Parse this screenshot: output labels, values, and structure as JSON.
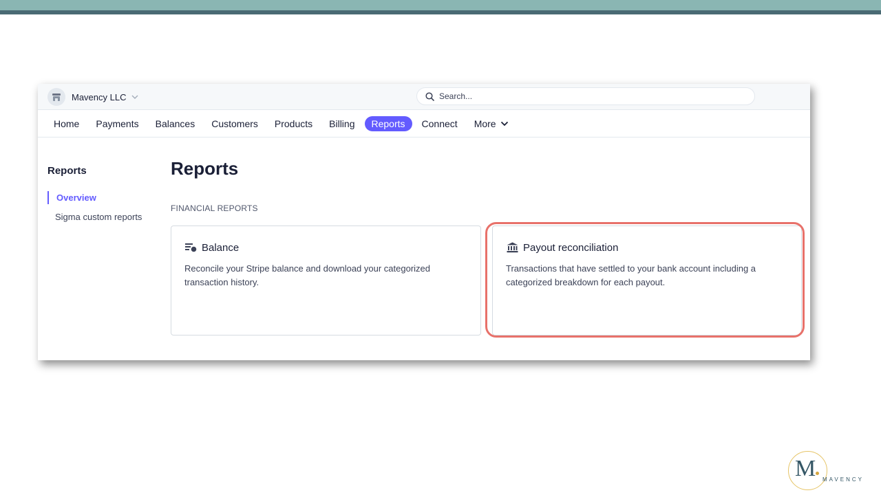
{
  "colors": {
    "accent": "#635bff",
    "highlight_ring": "#e8716a",
    "band_top": "#8ab6b3",
    "band_line": "#4a6a74",
    "logo_gold": "#e6c466",
    "logo_text": "#355766"
  },
  "topbar": {
    "account_name": "Mavency LLC",
    "account_icon": "store-icon",
    "search_placeholder": "Search..."
  },
  "nav": {
    "items": [
      {
        "label": "Home",
        "active": false
      },
      {
        "label": "Payments",
        "active": false
      },
      {
        "label": "Balances",
        "active": false
      },
      {
        "label": "Customers",
        "active": false
      },
      {
        "label": "Products",
        "active": false
      },
      {
        "label": "Billing",
        "active": false
      },
      {
        "label": "Reports",
        "active": true
      },
      {
        "label": "Connect",
        "active": false
      },
      {
        "label": "More",
        "active": false
      }
    ]
  },
  "sidebar": {
    "title": "Reports",
    "items": [
      {
        "label": "Overview",
        "active": true
      },
      {
        "label": "Sigma custom reports",
        "active": false
      }
    ]
  },
  "main": {
    "title": "Reports",
    "section_label": "FINANCIAL REPORTS",
    "cards": [
      {
        "icon": "balance-report-icon",
        "title": "Balance",
        "description": "Reconcile your Stripe balance and download your categorized transaction history."
      },
      {
        "icon": "bank-icon",
        "title": "Payout reconciliation",
        "description": "Transactions that have settled to your bank account including a categorized breakdown for each payout."
      }
    ]
  },
  "logo": {
    "letter": "M",
    "wordmark": "MAVENCY"
  }
}
